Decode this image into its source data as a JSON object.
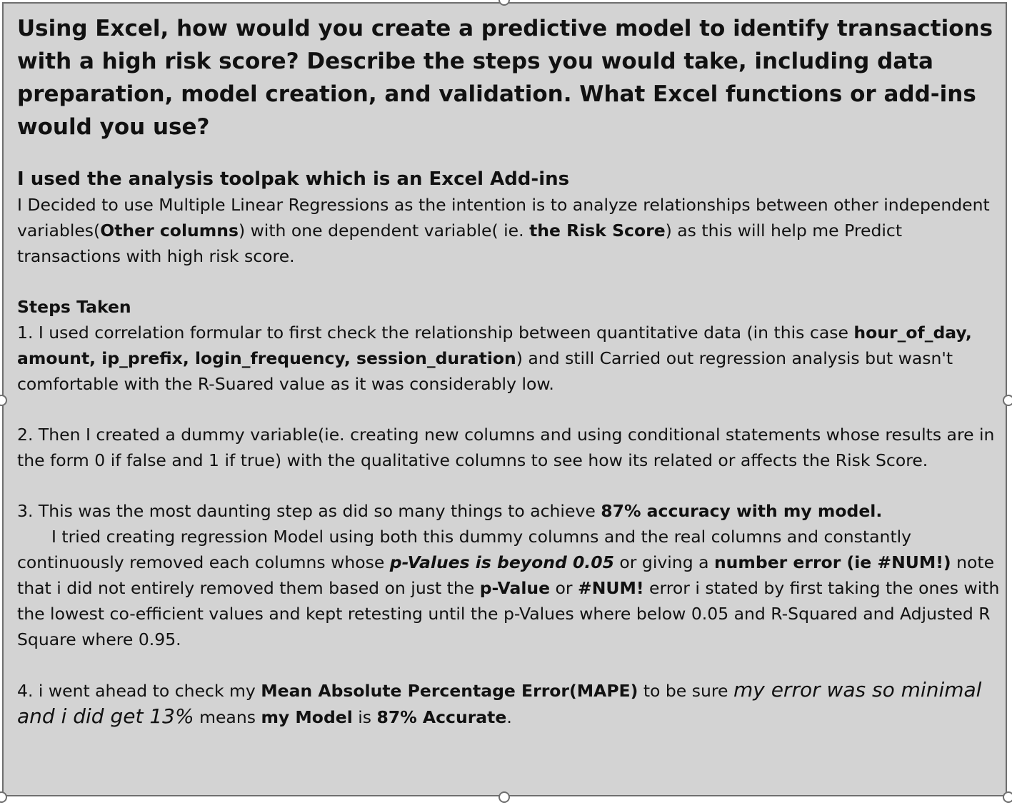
{
  "question": "Using Excel, how would you create a predictive model to identify transactions with a high risk score? Describe the steps you would take, including data preparation, model creation, and validation. What Excel functions or add-ins would you use?",
  "toolpak_heading": "I used the analysis toolpak which is an Excel Add-ins",
  "intro": {
    "p1": "I Decided to use Multiple Linear Regressions as the intention is to analyze relationships between other independent variables(",
    "b1": "Other columns",
    "p2": ") with one dependent variable( ie. ",
    "b2": "the Risk Score",
    "p3": ") as this will help me Predict transactions with high risk score."
  },
  "steps_heading": "Steps Taken",
  "step1": {
    "p1": "1. I used correlation formular to first check the relationship between quantitative data (in this case ",
    "b1": "hour_of_day, amount, ip_prefix, login_frequency, session_duration",
    "p2": ") and still Carried out regression analysis but wasn't comfortable with the R-Suared value as it was considerably low."
  },
  "step2": {
    "p1": "2. Then I created a dummy variable(ie. creating new columns and using conditional statements whose results are in the form 0 if false and 1 if true) with the qualitative columns to see how its related or affects the Risk Score."
  },
  "step3": {
    "p1": "3. This was the most daunting step as did so many things to achieve ",
    "b1": "87% accuracy with my model.",
    "p2": "I tried creating regression Model using both this dummy columns and the real columns and constantly continuously removed each columns whose ",
    "bi1": "p-Values is beyond 0.05",
    "p3": " or giving a ",
    "b2": "number error (ie  #NUM!)",
    "p4": " note that i did not entirely removed them based on just the ",
    "b3": "p-Value",
    "p5": " or ",
    "b4": "#NUM!",
    "p6": " error i stated by first taking the ones with the lowest co-efficient values and kept retesting until the p-Values where below 0.05 and R-Squared and Adjusted R Square where 0.95."
  },
  "step4": {
    "p1": "4. i went ahead to check my ",
    "b1": "Mean Absolute Percentage Error(MAPE)",
    "p2": " to be sure ",
    "i1": "my error was so minimal and i did get 13%",
    "p3": " means ",
    "b2": "my Model",
    "p4": " is ",
    "b3": "87% Accurate",
    "p5": "."
  },
  "colors": {
    "textbox_fill": "#d3d3d3",
    "border": "#6e6e6e",
    "text": "#111111"
  }
}
